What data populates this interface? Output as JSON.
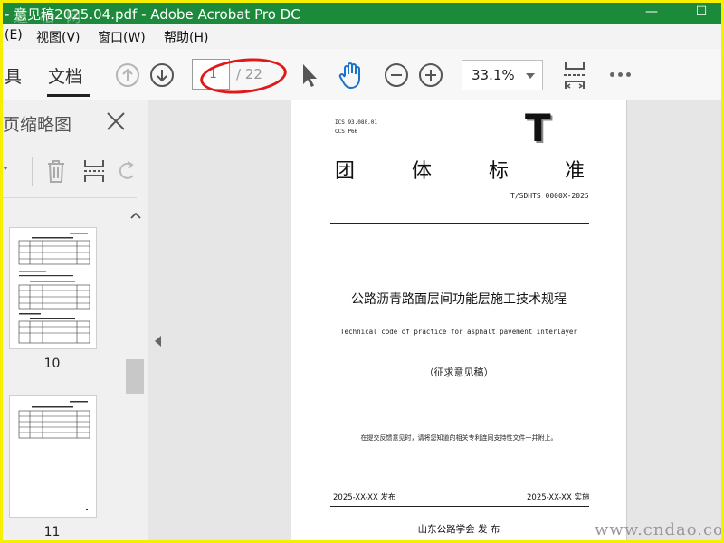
{
  "window": {
    "title": "- 意见稿2025.04.pdf - Adobe Acrobat Pro DC",
    "watermark_logo": "道 松 网",
    "minimize_glyph": "—",
    "maximize_glyph": "☐"
  },
  "menu": {
    "items": [
      {
        "label": "(E)"
      },
      {
        "label": "视图(V)"
      },
      {
        "label": "窗口(W)"
      },
      {
        "label": "帮助(H)"
      }
    ]
  },
  "toolbar": {
    "tab_tools": "具",
    "tab_document": "文档",
    "page_current": "1",
    "page_total": "/ 22",
    "zoom": "33.1%",
    "icons": [
      "arrow-up-circle-icon",
      "arrow-down-circle-icon",
      "select-cursor-icon",
      "hand-icon",
      "zoom-out-icon",
      "zoom-in-icon",
      "fit-page-icon",
      "more-icon"
    ]
  },
  "thumbnail_panel": {
    "title": "页缩略图",
    "thumbnails": [
      {
        "page_label": "10"
      },
      {
        "page_label": "11"
      }
    ]
  },
  "document_page": {
    "ics": "ICS 93.080.01",
    "ccs": "CCS P66",
    "type_letter": "T",
    "standard_chars": [
      "团",
      "体",
      "标",
      "准"
    ],
    "standard_code": "T/SDHTS  0000X-2025",
    "title_cn": "公路沥青路面层间功能层施工技术规程",
    "title_en": "Technical code of practice for asphalt pavement interlayer",
    "draft": "（征求意见稿）",
    "note": "在提交反馈意见时，请将您知道的相关专利连同支持性文件一并附上。",
    "issue_date": "2025-XX-XX 发布",
    "impl_date": "2025-XX-XX 实施",
    "publisher": "山东公路学会   发 布"
  },
  "site_watermark": "www.cndao.com",
  "colors": {
    "titlebar": "#1b8a3a",
    "frame": "#f5f000",
    "annotation": "#e01818"
  }
}
